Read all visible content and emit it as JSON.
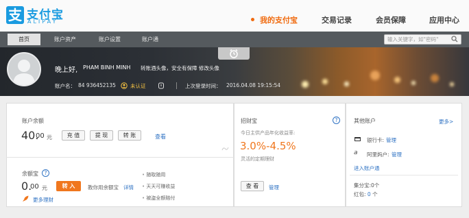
{
  "brand": {
    "logo_glyph": "支",
    "name_cn": "支付宝",
    "name_en": "ALIPAY",
    "color": "#1a9be0"
  },
  "nav": {
    "items": [
      {
        "label": "我的支付宝",
        "active": true
      },
      {
        "label": "交易记录"
      },
      {
        "label": "会员保障"
      },
      {
        "label": "应用中心"
      }
    ]
  },
  "subnav": {
    "items": [
      "首页",
      "账户资产",
      "账户设置",
      "账户通"
    ],
    "active_index": 0
  },
  "search": {
    "placeholder": "输入关键字，如\"密码\""
  },
  "profile": {
    "greeting": "晚上好,",
    "name": "PHAM BINH MINH",
    "links": "转账酒头像，安全有保障 修改头像",
    "account_label": "账户名：",
    "account_value": "84 936452135",
    "auth_status": "未认证",
    "last_login_label": "上次登录时间：",
    "last_login_value": "2016.04.08 19:15:54"
  },
  "balance": {
    "title": "账户余额",
    "amount": "40.",
    "cents": "00",
    "unit": "元",
    "btn_recharge": "充 值",
    "btn_withdraw": "提 现",
    "btn_transfer": "转 账",
    "view_link": "查看"
  },
  "yuebao": {
    "title": "余额宝",
    "amount": "0.",
    "cents": "00",
    "unit": "元",
    "btn_in": "转 入",
    "desc": "教你用余额宝",
    "detail_link": "详情",
    "features": [
      "随取随用",
      "天天可赚收益",
      "被盗全额赔付"
    ],
    "more_link": "更多理财"
  },
  "zhaocai": {
    "title": "招财宝",
    "desc1": "今日主供产品年化收益率:",
    "rate": "3.0%-4.5%",
    "desc2": "灵活的定期理财",
    "btn_view": "查 看",
    "manage_link": "管理"
  },
  "others": {
    "title": "其他账户",
    "more_link": "更多>",
    "bank_label": "银行卡:",
    "bank_link": "管理",
    "alimama_label": "阿里妈户:",
    "alimama_link": "管理",
    "enter_link": "进入账户通",
    "jifen_label": "集分宝:",
    "jifen_value": "0个",
    "hongbao_label": "红包:",
    "hongbao_value": "0",
    "hongbao_unit": "个"
  },
  "colors": {
    "accent": "#f06a0e",
    "link": "#2e72c3",
    "subbar": "#555a5e"
  }
}
